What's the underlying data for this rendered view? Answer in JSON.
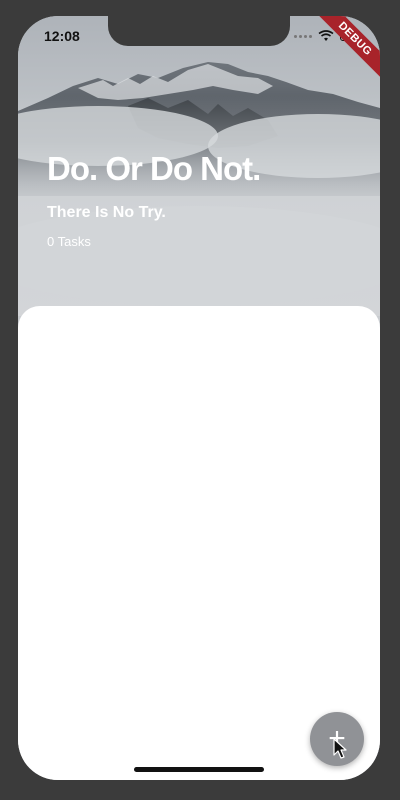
{
  "status_bar": {
    "time": "12:08",
    "debug_label": "DEBUG",
    "wifi_icon": "wifi-icon",
    "battery_icon": "battery-icon"
  },
  "header": {
    "headline": "Do. Or Do Not.",
    "subheadline": "There Is No Try.",
    "task_count": "0 Tasks",
    "background": "mountain-fog-image"
  },
  "fab": {
    "label": "+",
    "icon": "plus-icon",
    "color": "#909296"
  },
  "colors": {
    "device_frame": "#3b3b3b",
    "panel": "#ffffff",
    "text_on_hero": "#ffffff",
    "debug_ribbon": "#a8232a"
  }
}
